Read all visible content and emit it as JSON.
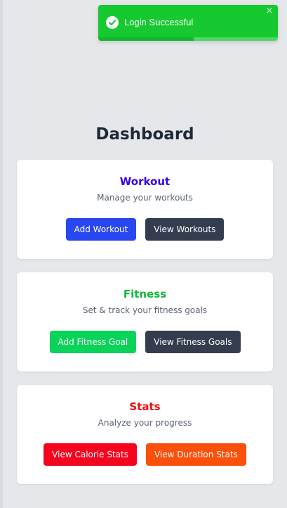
{
  "toast": {
    "message": "Login Successful",
    "close_glyph": "×",
    "icon": "check-circle-icon",
    "progress_fraction": 0.53,
    "color": "#16c930"
  },
  "page": {
    "title": "Dashboard"
  },
  "cards": {
    "workout": {
      "title": "Workout",
      "title_color": "#3700e6",
      "subtitle": "Manage your workouts",
      "primary_label": "Add Workout",
      "primary_color": "#2847f0",
      "secondary_label": "View Workouts"
    },
    "fitness": {
      "title": "Fitness",
      "title_color": "#12b83c",
      "subtitle": "Set & track your fitness goals",
      "primary_label": "Add Fitness Goal",
      "primary_color": "#0ad35a",
      "secondary_label": "View Fitness Goals"
    },
    "stats": {
      "title": "Stats",
      "title_color": "#ee0c0c",
      "subtitle": "Analyze your progress",
      "primary_label": "View Calorie Stats",
      "primary_color": "#f5041e",
      "secondary_label": "View Duration Stats",
      "secondary_color": "#fb4f0a"
    }
  },
  "colors": {
    "background": "#e5e7eb",
    "dark_button": "#333d4e"
  }
}
